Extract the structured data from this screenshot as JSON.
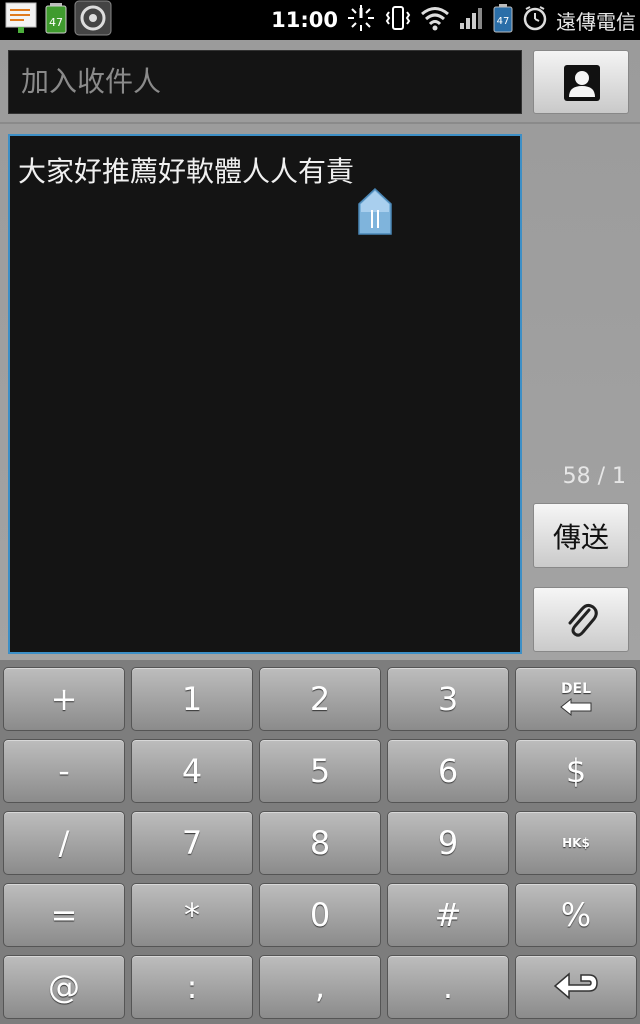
{
  "status_bar": {
    "time": "11:00",
    "carrier": "遠傳電信",
    "battery_badge": "47",
    "icons": [
      "notes-icon",
      "battery-47-icon",
      "app-notification-icon",
      "alarm-icon",
      "vibrate-icon",
      "wifi-icon",
      "signal-icon",
      "battery-icon",
      "clock-icon"
    ]
  },
  "compose": {
    "recipient_placeholder": "加入收件人",
    "message_text": "大家好推薦好軟體人人有責",
    "counter": "58 / 1",
    "send_label": "傳送"
  },
  "keyboard": {
    "keys": [
      [
        "+",
        "1",
        "2",
        "3",
        "DEL"
      ],
      [
        "-",
        "4",
        "5",
        "6",
        "$"
      ],
      [
        "/",
        "7",
        "8",
        "9",
        "HK$"
      ],
      [
        "=",
        "*",
        "0",
        "#",
        "%"
      ],
      [
        "@",
        ":",
        ",",
        ".",
        "enter"
      ]
    ]
  },
  "colors": {
    "focus_border": "#3d8fc6",
    "field_bg": "#141414",
    "panel_bg": "#9b9b9b"
  }
}
